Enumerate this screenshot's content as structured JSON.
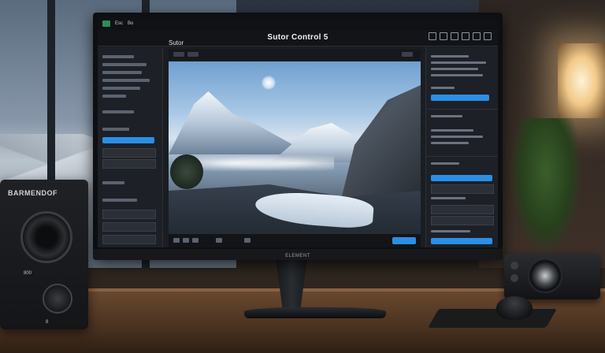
{
  "monitor": {
    "app_title": "Sutor Control 5",
    "menu": [
      "",
      "Esc",
      "Bo",
      "",
      ""
    ],
    "left_title": "Sutor",
    "brand": "ELEMENT"
  },
  "speaker": {
    "brand": "BARMENDOF",
    "label_mid": "800",
    "label_bottom": "8"
  },
  "colors": {
    "accent": "#2b8fe6",
    "ui_dark": "#1d2026"
  }
}
